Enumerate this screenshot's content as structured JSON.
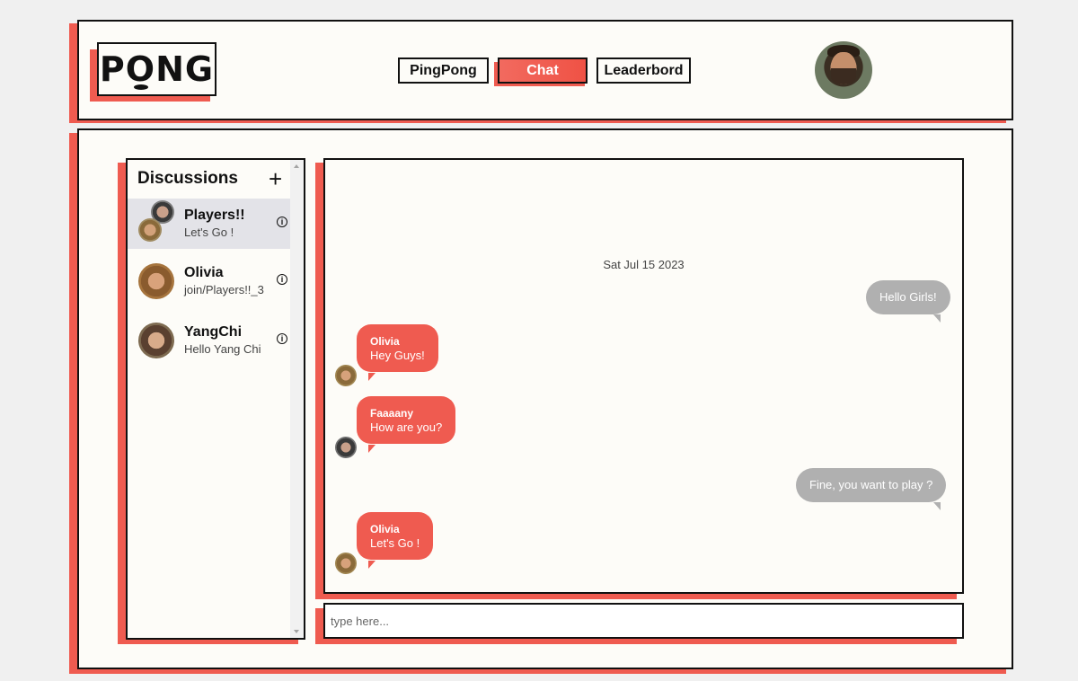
{
  "logo": {
    "text": "PONG"
  },
  "nav": {
    "pingpong": "PingPong",
    "chat": "Chat",
    "leaderbord": "Leaderbord"
  },
  "sidebar": {
    "title": "Discussions",
    "add_label": "+",
    "items": [
      {
        "name": "Players!!",
        "last": "Let's Go !",
        "active": true
      },
      {
        "name": "Olivia",
        "last": "join/Players!!_3",
        "active": false
      },
      {
        "name": "YangChi",
        "last": "Hello Yang Chi",
        "active": false
      }
    ]
  },
  "chat": {
    "date": "Sat Jul 15 2023",
    "messages": [
      {
        "own": true,
        "text": "Hello Girls!"
      },
      {
        "own": false,
        "sender": "Olivia",
        "text": "Hey Guys!"
      },
      {
        "own": false,
        "sender": "Faaaany",
        "text": "How are you?"
      },
      {
        "own": true,
        "text": "Fine, you want to play ?"
      },
      {
        "own": false,
        "sender": "Olivia",
        "text": "Let's Go !"
      }
    ]
  },
  "input": {
    "placeholder": "type here..."
  },
  "colors": {
    "accent": "#ef5b50",
    "own_bubble": "#b0b0b0",
    "background": "#fdfcf8"
  }
}
